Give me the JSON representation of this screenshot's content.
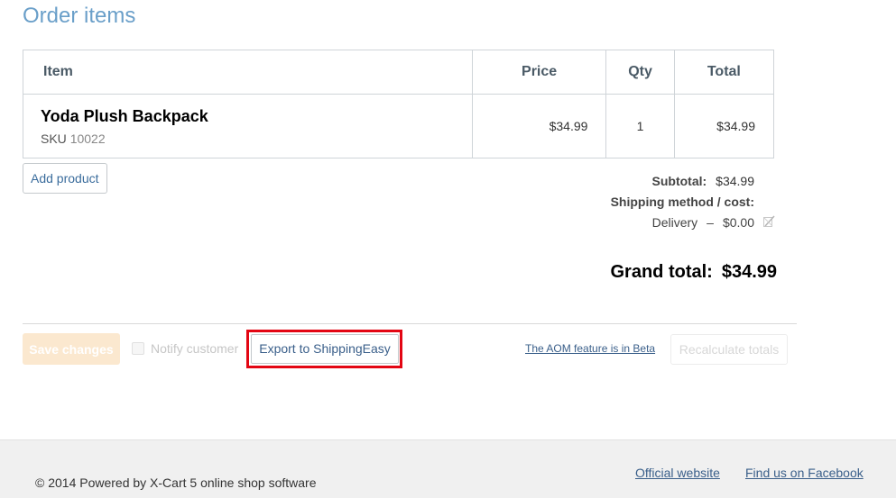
{
  "page": {
    "title": "Order items"
  },
  "table": {
    "headers": {
      "item": "Item",
      "price": "Price",
      "qty": "Qty",
      "total": "Total"
    },
    "rows": [
      {
        "name": "Yoda Plush Backpack",
        "sku_label": "SKU",
        "sku": "10022",
        "price": "$34.99",
        "qty": "1",
        "total": "$34.99"
      }
    ]
  },
  "actions": {
    "add_product": "Add product",
    "save_changes": "Save changes",
    "notify_customer": "Notify customer",
    "export": "Export to ShippingEasy",
    "beta_link": "The AOM feature is in Beta",
    "recalculate": "Recalculate totals"
  },
  "totals": {
    "subtotal_label": "Subtotal:",
    "subtotal": "$34.99",
    "shipping_label": "Shipping method / cost:",
    "shipping_method": "Delivery",
    "shipping_dash": "–",
    "shipping_cost": "$0.00",
    "grand_label": "Grand total:",
    "grand": "$34.99"
  },
  "footer": {
    "copyright": "© 2014 Powered by X-Cart 5 online shop software",
    "links": [
      "Official website",
      "Find us on Facebook"
    ]
  },
  "colors": {
    "title": "#6a9fc9",
    "highlight": "#e30613",
    "link": "#3a5f8a"
  },
  "icons": {
    "shipping_edit": "edit-disabled-icon"
  }
}
